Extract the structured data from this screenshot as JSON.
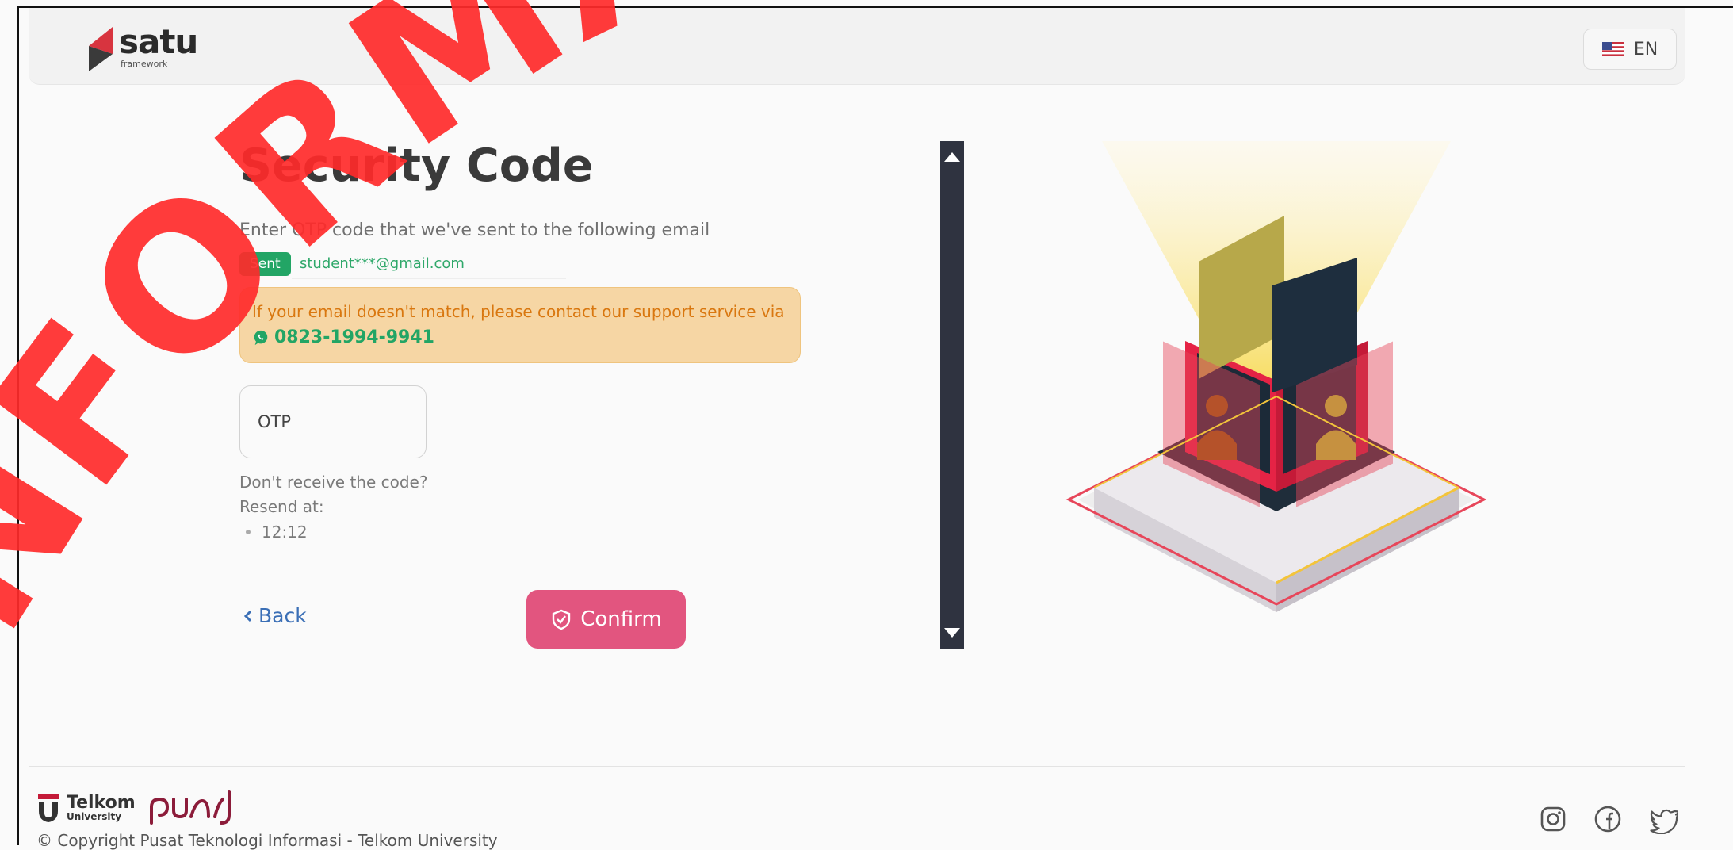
{
  "header": {
    "logo_text": "satu",
    "logo_subtext": "framework",
    "language_label": "EN"
  },
  "form": {
    "title": "Security Code",
    "subtitle": "Enter OTP code that we've sent to the following email",
    "sent_badge": "Sent",
    "email": "student***@gmail.com",
    "alert_text": "If your email doesn't match, please contact our support service via",
    "alert_phone": "0823-1994-9941",
    "otp_placeholder": "OTP",
    "resend_question": "Don't receive the code?",
    "resend_at_label": "Resend at:",
    "resend_time": "12:12",
    "back_label": "Back",
    "confirm_label": "Confirm"
  },
  "footer": {
    "university_name": "Telkom",
    "university_sub": "University",
    "copyright": "© Copyright Pusat Teknologi Informasi - Telkom University",
    "social_icons": [
      "instagram-icon",
      "facebook-icon",
      "twitter-icon"
    ]
  },
  "watermark": {
    "text": "INFORMASI PU",
    "color": "#ff2a2a"
  },
  "colors": {
    "accent": "#e2557f",
    "success": "#22a565",
    "warning_bg": "#f6d6a4",
    "warning_text": "#d9770f",
    "link": "#3b6fb6",
    "scrollbar": "#2f3340"
  }
}
